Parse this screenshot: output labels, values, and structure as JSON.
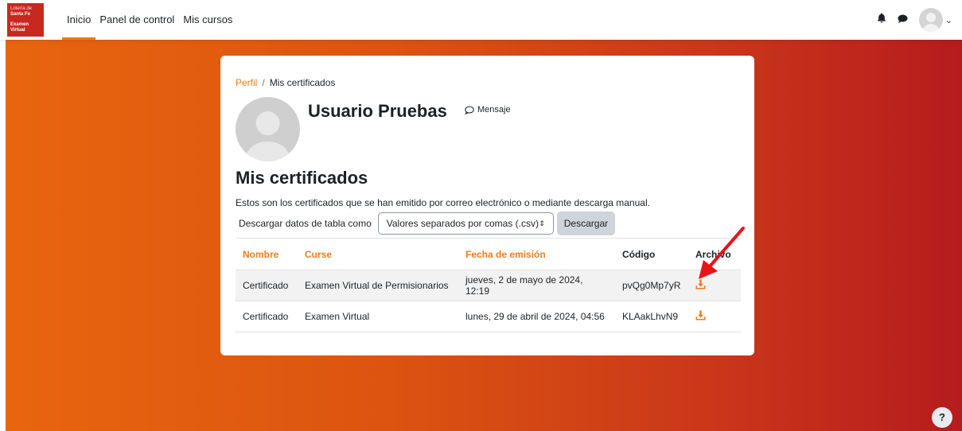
{
  "brand": {
    "logo_line1": "Lotería de",
    "logo_line2": "Santa Fe",
    "logo_line3": "Examen",
    "logo_line4": "Virtual",
    "accent": "#f07a1a"
  },
  "nav": {
    "items": [
      "Inicio",
      "Panel de control",
      "Mis cursos"
    ],
    "active": "Inicio"
  },
  "icons": [
    "bell-icon",
    "chat-icon",
    "user-avatar",
    "chevron-down-icon"
  ],
  "breadcrumb": {
    "link": "Perfil",
    "separator": "/",
    "current": "Mis certificados"
  },
  "profile": {
    "name": "Usuario Pruebas",
    "message_label": "Mensaje"
  },
  "certificates": {
    "title": "Mis certificados",
    "description": "Estos son los certificados que se han emitido por correo electrónico o mediante descarga manual.",
    "download_label": "Descargar datos de tabla como",
    "format_selected": "Valores separados por comas (.csv)",
    "download_button": "Descargar",
    "columns": [
      "Nombre",
      "Curse",
      "Fecha de emisión",
      "Código",
      "Archivo"
    ],
    "rows": [
      [
        "Certificado",
        "Examen Virtual de Permisionarios",
        "jueves, 2 de mayo de 2024, 12:19",
        "pvQg0Mp7yR"
      ],
      [
        "Certificado",
        "Examen Virtual",
        "lunes, 29 de abril de 2024, 04:56",
        "KLAakLhvN9"
      ]
    ]
  },
  "help_label": "?"
}
